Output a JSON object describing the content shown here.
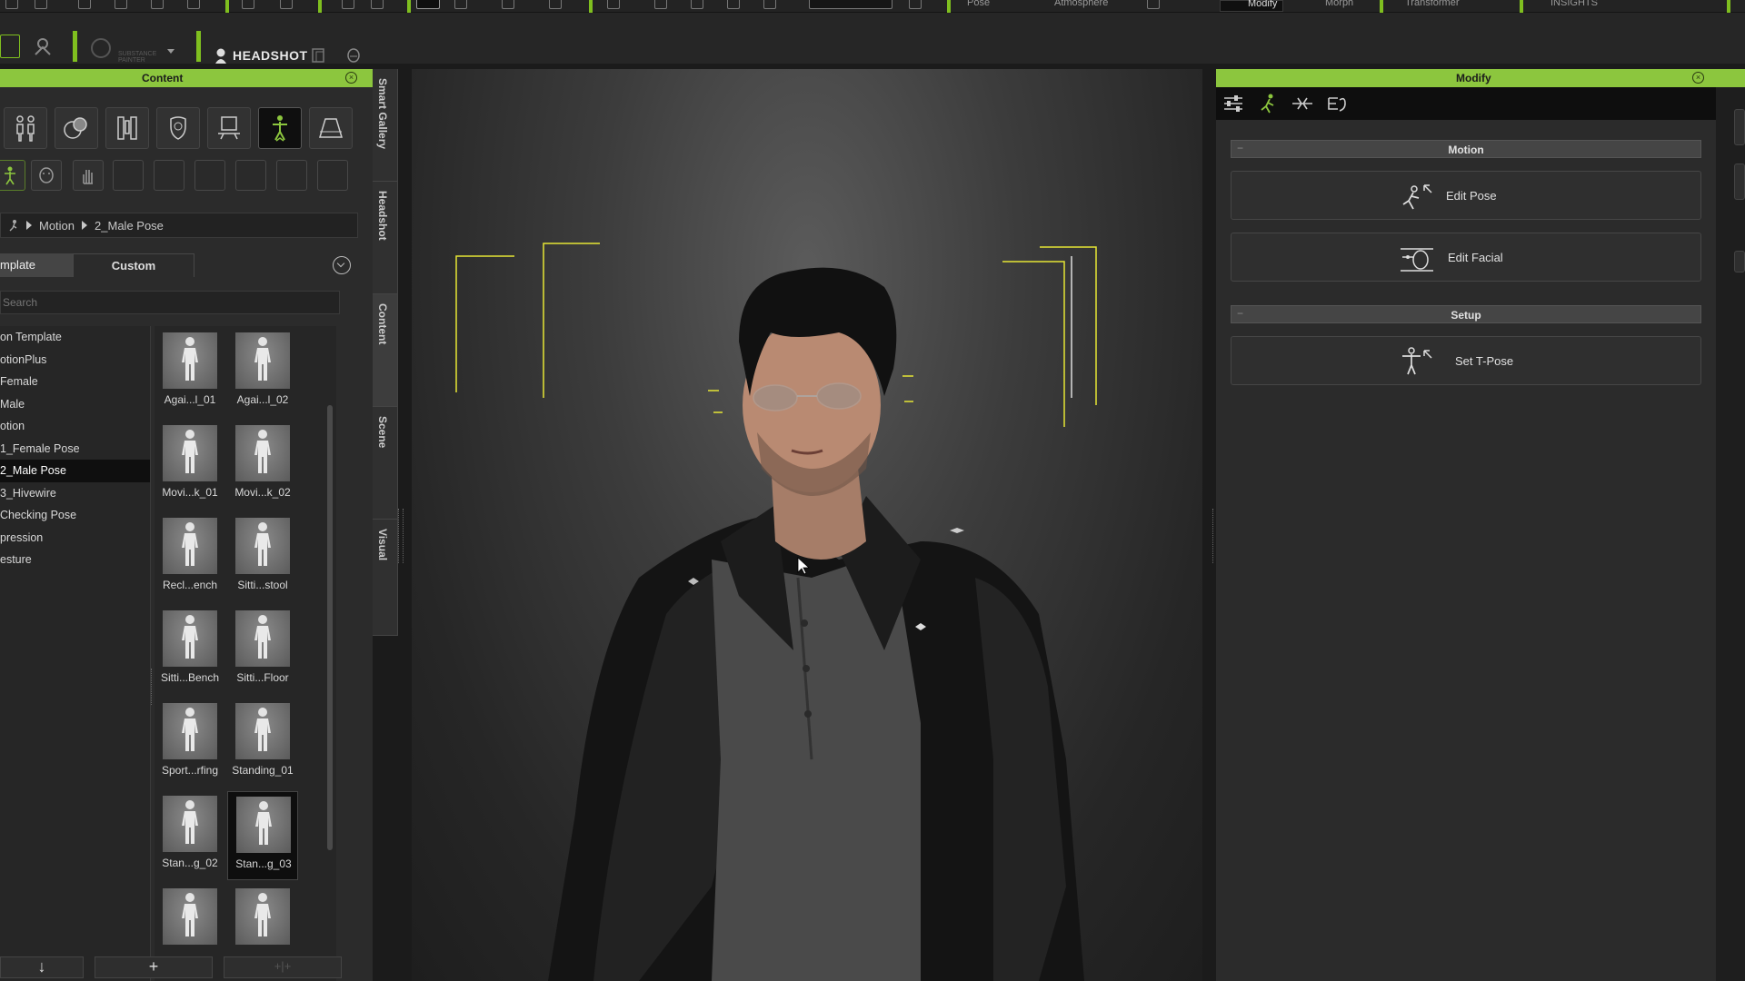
{
  "toolbar": {
    "items": [
      {
        "label": "Pose"
      },
      {
        "label": "Atmosphere"
      },
      {
        "label": "Modify"
      },
      {
        "label": "Morph"
      },
      {
        "label": "Transformer"
      },
      {
        "label": "INSIGHTS"
      }
    ],
    "headshot_label": "HEADSHOT",
    "substance_label": "SUBSTANCE PAINTER",
    "accent_color": "#8cc63e"
  },
  "content_panel": {
    "title": "Content",
    "breadcrumb": [
      "Motion",
      "2_Male Pose"
    ],
    "tabs": {
      "template": "mplate",
      "custom": "Custom"
    },
    "search_placeholder": "Search",
    "tree": [
      {
        "label": "on Template"
      },
      {
        "label": "otionPlus"
      },
      {
        "label": "Female"
      },
      {
        "label": "Male"
      },
      {
        "label": "otion"
      },
      {
        "label": "1_Female Pose"
      },
      {
        "label": "2_Male Pose"
      },
      {
        "label": "3_Hivewire"
      },
      {
        "label": "Checking Pose"
      },
      {
        "label": "pression"
      },
      {
        "label": "esture"
      }
    ],
    "selected_tree_index": 6,
    "thumbnails": [
      {
        "label": "Agai...l_01"
      },
      {
        "label": "Agai...l_02"
      },
      {
        "label": "Movi...k_01"
      },
      {
        "label": "Movi...k_02"
      },
      {
        "label": "Recl...ench"
      },
      {
        "label": "Sitti...stool"
      },
      {
        "label": "Sitti...Bench"
      },
      {
        "label": "Sitti...Floor"
      },
      {
        "label": "Sport...rfing"
      },
      {
        "label": "Standing_01"
      },
      {
        "label": "Stan...g_02"
      },
      {
        "label": "Stan...g_03"
      },
      {
        "label": ""
      },
      {
        "label": ""
      }
    ],
    "selected_thumb_index": 11,
    "bottom_buttons": [
      "↓",
      "+",
      "+|+"
    ]
  },
  "side_tabs": [
    {
      "label": "Smart Gallery"
    },
    {
      "label": "Headshot"
    },
    {
      "label": "Content"
    },
    {
      "label": "Scene"
    },
    {
      "label": "Visual"
    }
  ],
  "modify_panel": {
    "title": "Modify",
    "motion_section": "Motion",
    "edit_pose": "Edit Pose",
    "edit_facial": "Edit Facial",
    "setup_section": "Setup",
    "set_tpose": "Set T-Pose"
  }
}
